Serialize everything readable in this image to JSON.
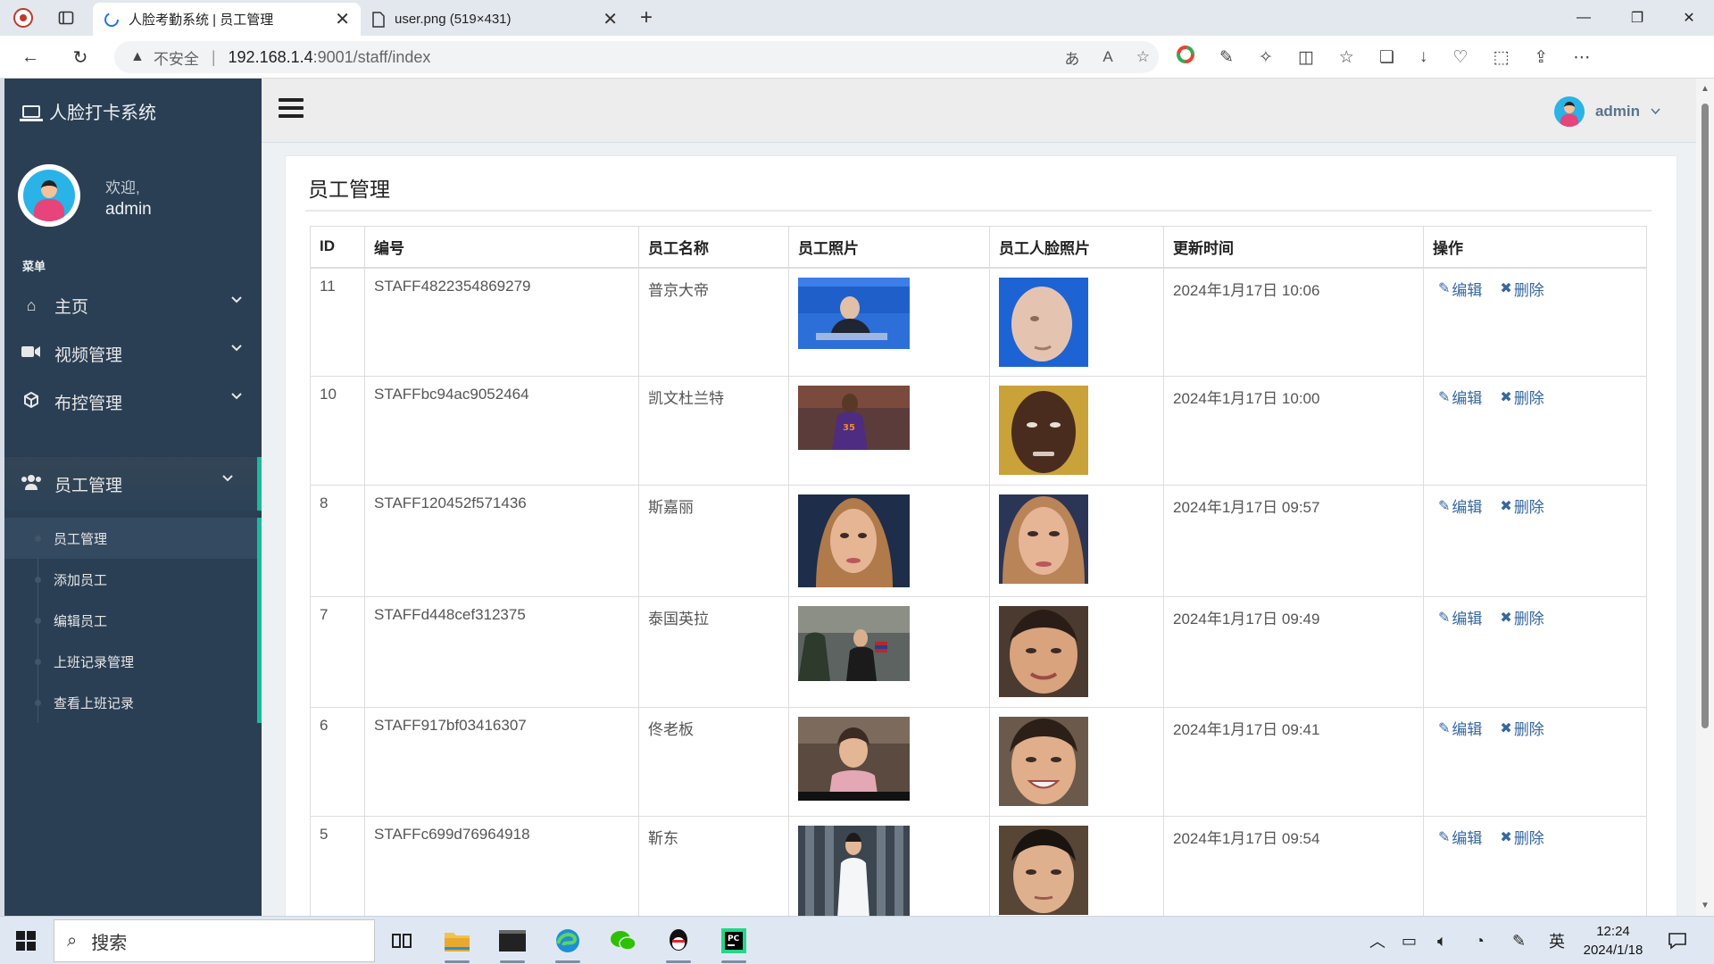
{
  "browser": {
    "tabs": [
      {
        "title": "人脸考勤系统 | 员工管理",
        "active": true
      },
      {
        "title": "user.png (519×431)",
        "active": false
      }
    ],
    "security_label": "不安全",
    "url_host": "192.168.1.4",
    "url_path": ":9001/staff/index"
  },
  "sidebar": {
    "brand": "人脸打卡系统",
    "welcome": "欢迎,",
    "username": "admin",
    "menu_title": "菜单",
    "items": [
      {
        "label": "主页",
        "icon": "home-icon"
      },
      {
        "label": "视频管理",
        "icon": "video-icon"
      },
      {
        "label": "布控管理",
        "icon": "cube-icon"
      },
      {
        "label": "员工管理",
        "icon": "users-icon"
      }
    ],
    "submenu": [
      {
        "label": "员工管理",
        "current": true
      },
      {
        "label": "添加员工",
        "current": false
      },
      {
        "label": "编辑员工",
        "current": false
      },
      {
        "label": "上班记录管理",
        "current": false
      },
      {
        "label": "查看上班记录",
        "current": false
      }
    ]
  },
  "topnav": {
    "user": "admin"
  },
  "panel": {
    "title": "员工管理",
    "columns": [
      "ID",
      "编号",
      "员工名称",
      "员工照片",
      "员工人脸照片",
      "更新时间",
      "操作"
    ],
    "edit_label": "编辑",
    "delete_label": "删除",
    "rows": [
      {
        "id": "11",
        "code": "STAFF4822354869279",
        "name": "普京大帝",
        "time": "2024年1月17日 10:06"
      },
      {
        "id": "10",
        "code": "STAFFbc94ac9052464",
        "name": "凯文杜兰特",
        "time": "2024年1月17日 10:00"
      },
      {
        "id": "8",
        "code": "STAFF120452f571436",
        "name": "斯嘉丽",
        "time": "2024年1月17日 09:57"
      },
      {
        "id": "7",
        "code": "STAFFd448cef312375",
        "name": "泰国英拉",
        "time": "2024年1月17日 09:49"
      },
      {
        "id": "6",
        "code": "STAFF917bf03416307",
        "name": "佟老板",
        "time": "2024年1月17日 09:41"
      },
      {
        "id": "5",
        "code": "STAFFc699d76964918",
        "name": "靳东",
        "time": "2024年1月17日 09:54"
      }
    ]
  },
  "taskbar": {
    "search_placeholder": "搜索",
    "ime": "英",
    "time": "12:24",
    "date": "2024/1/18"
  },
  "colors": {
    "sidebar_bg": "#2a3f54",
    "accent": "#1abb9c",
    "link": "#35679f"
  }
}
